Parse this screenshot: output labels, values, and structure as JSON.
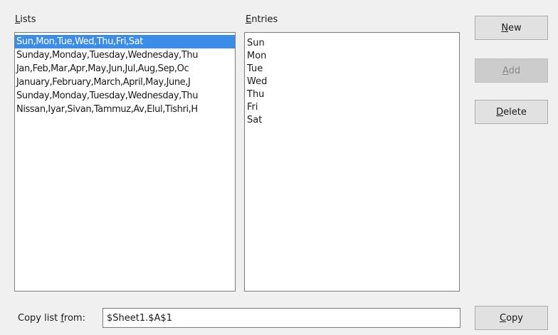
{
  "lists": {
    "label_first": "L",
    "label_rest": "ists",
    "items": [
      "Sun,Mon,Tue,Wed,Thu,Fri,Sat",
      "Sunday,Monday,Tuesday,Wednesday,Thu",
      "Jan,Feb,Mar,Apr,May,Jun,Jul,Aug,Sep,Oc",
      "January,February,March,April,May,June,J",
      "Sunday,Monday,Tuesday,Wednesday,Thu",
      "Nissan,Iyar,Sivan,Tammuz,Av,Elul,Tishri,H"
    ]
  },
  "entries": {
    "label_first": "E",
    "label_rest": "ntries",
    "items": [
      "Sun",
      "Mon",
      "Tue",
      "Wed",
      "Thu",
      "Fri",
      "Sat"
    ]
  },
  "buttons": {
    "new_label": "New",
    "add_label": "Add",
    "delete_label": "Delete",
    "copy_label": "Copy"
  },
  "copy_from": {
    "label_pre": "Copy list ",
    "label_ul": "f",
    "label_post": "rom:",
    "value": "$Sheet1.$A$1"
  }
}
